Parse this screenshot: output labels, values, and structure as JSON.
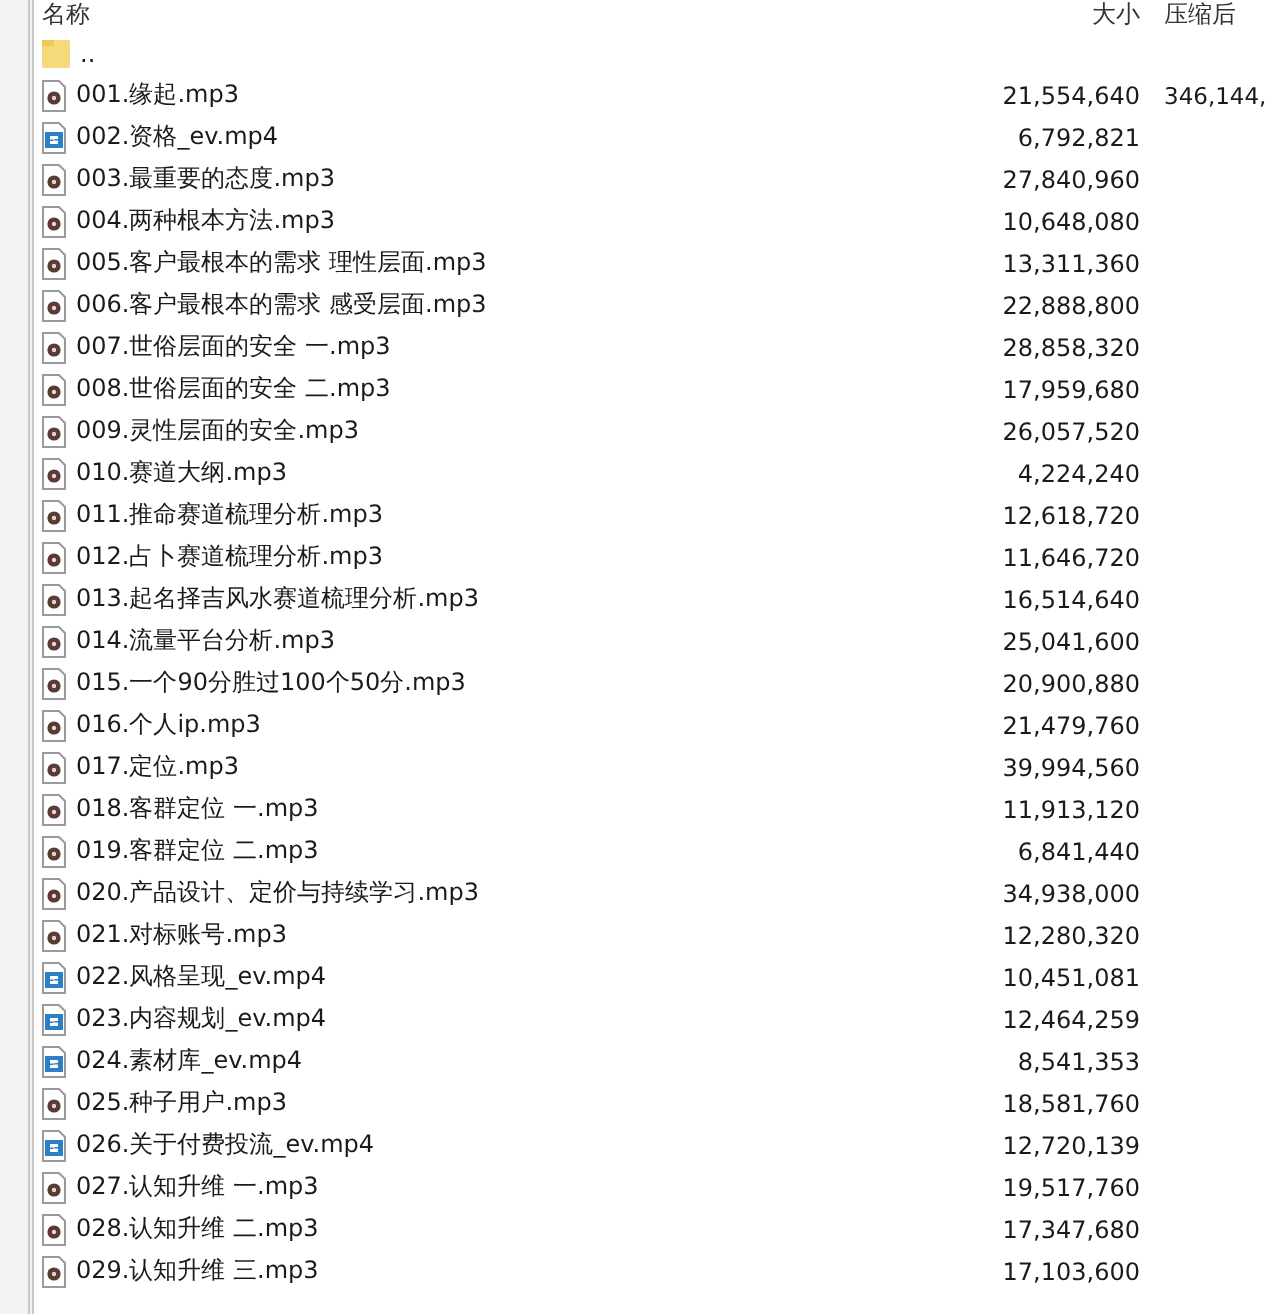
{
  "columns": [
    {
      "label": "名称"
    },
    {
      "label": "大小"
    },
    {
      "label": "压缩后"
    }
  ],
  "rows": [
    {
      "kind": "folder",
      "name": ".."
    },
    {
      "kind": "audio",
      "name": "001.缘起.mp3",
      "size": "21,554,640",
      "packed": "346,144,"
    },
    {
      "kind": "video",
      "name": "002.资格_ev.mp4",
      "size": "6,792,821"
    },
    {
      "kind": "audio",
      "name": "003.最重要的态度.mp3",
      "size": "27,840,960"
    },
    {
      "kind": "audio",
      "name": "004.两种根本方法.mp3",
      "size": "10,648,080"
    },
    {
      "kind": "audio",
      "name": "005.客户最根本的需求 理性层面.mp3",
      "size": "13,311,360"
    },
    {
      "kind": "audio",
      "name": "006.客户最根本的需求 感受层面.mp3",
      "size": "22,888,800"
    },
    {
      "kind": "audio",
      "name": "007.世俗层面的安全 一.mp3",
      "size": "28,858,320"
    },
    {
      "kind": "audio",
      "name": "008.世俗层面的安全 二.mp3",
      "size": "17,959,680"
    },
    {
      "kind": "audio",
      "name": "009.灵性层面的安全.mp3",
      "size": "26,057,520"
    },
    {
      "kind": "audio",
      "name": "010.赛道大纲.mp3",
      "size": "4,224,240"
    },
    {
      "kind": "audio",
      "name": "011.推命赛道梳理分析.mp3",
      "size": "12,618,720"
    },
    {
      "kind": "audio",
      "name": "012.占卜赛道梳理分析.mp3",
      "size": "11,646,720"
    },
    {
      "kind": "audio",
      "name": "013.起名择吉风水赛道梳理分析.mp3",
      "size": "16,514,640"
    },
    {
      "kind": "audio",
      "name": "014.流量平台分析.mp3",
      "size": "25,041,600"
    },
    {
      "kind": "audio",
      "name": "015.一个90分胜过100个50分.mp3",
      "size": "20,900,880"
    },
    {
      "kind": "audio",
      "name": "016.个人ip.mp3",
      "size": "21,479,760"
    },
    {
      "kind": "audio",
      "name": "017.定位.mp3",
      "size": "39,994,560"
    },
    {
      "kind": "audio",
      "name": "018.客群定位 一.mp3",
      "size": "11,913,120"
    },
    {
      "kind": "audio",
      "name": "019.客群定位 二.mp3",
      "size": "6,841,440"
    },
    {
      "kind": "audio",
      "name": "020.产品设计、定价与持续学习.mp3",
      "size": "34,938,000"
    },
    {
      "kind": "audio",
      "name": "021.对标账号.mp3",
      "size": "12,280,320"
    },
    {
      "kind": "video",
      "name": "022.风格呈现_ev.mp4",
      "size": "10,451,081"
    },
    {
      "kind": "video",
      "name": "023.内容规划_ev.mp4",
      "size": "12,464,259"
    },
    {
      "kind": "video",
      "name": "024.素材库_ev.mp4",
      "size": "8,541,353"
    },
    {
      "kind": "audio",
      "name": "025.种子用户.mp3",
      "size": "18,581,760"
    },
    {
      "kind": "video",
      "name": "026.关于付费投流_ev.mp4",
      "size": "12,720,139"
    },
    {
      "kind": "audio",
      "name": "027.认知升维 一.mp3",
      "size": "19,517,760"
    },
    {
      "kind": "audio",
      "name": "028.认知升维 二.mp3",
      "size": "17,347,680"
    },
    {
      "kind": "audio",
      "name": "029.认知升维 三.mp3",
      "size": "17,103,600"
    }
  ]
}
